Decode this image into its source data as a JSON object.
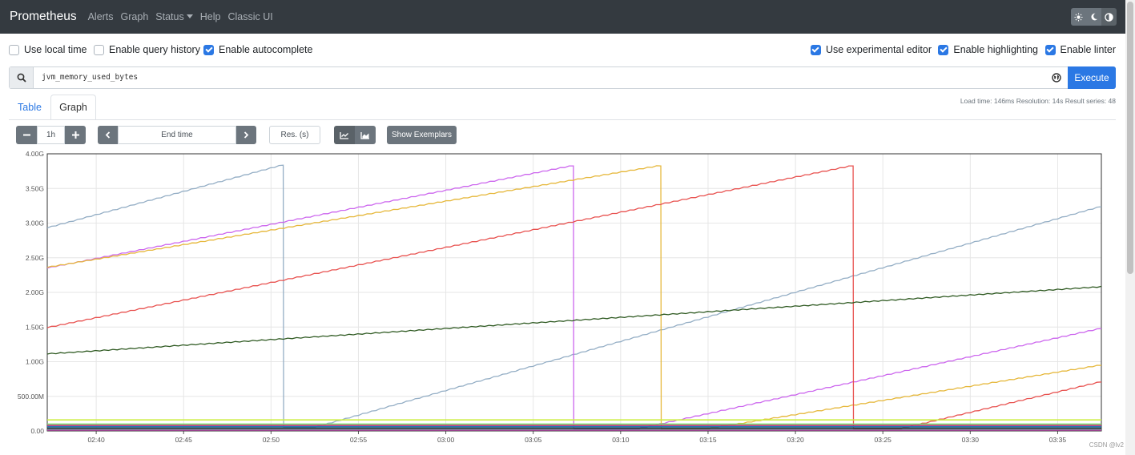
{
  "navbar": {
    "brand": "Prometheus",
    "links": [
      "Alerts",
      "Graph",
      "Status",
      "Help",
      "Classic UI"
    ],
    "theme_icons": [
      "light-theme-icon",
      "dark-theme-icon",
      "auto-theme-icon"
    ]
  },
  "options": {
    "use_local_time": {
      "label": "Use local time",
      "checked": false
    },
    "enable_query_history": {
      "label": "Enable query history",
      "checked": false
    },
    "enable_autocomplete": {
      "label": "Enable autocomplete",
      "checked": true
    },
    "use_experimental_editor": {
      "label": "Use experimental editor",
      "checked": true
    },
    "enable_highlighting": {
      "label": "Enable highlighting",
      "checked": true
    },
    "enable_linter": {
      "label": "Enable linter",
      "checked": true
    }
  },
  "query": {
    "expression": "jvm_memory_used_bytes",
    "execute_label": "Execute"
  },
  "tabs": {
    "table": "Table",
    "graph": "Graph"
  },
  "stats": {
    "text": "Load time: 146ms   Resolution: 14s   Result series: 48"
  },
  "controls": {
    "range": "1h",
    "end_time_placeholder": "End time",
    "resolution_placeholder": "Res. (s)",
    "show_exemplars": "Show Exemplars"
  },
  "colors": {
    "accent": "#2b78e4",
    "navbar": "#343a40"
  },
  "chart_data": {
    "type": "line",
    "y_ticks": [
      "4.00G",
      "3.50G",
      "3.00G",
      "2.50G",
      "2.00G",
      "1.50G",
      "1.00G",
      "500.00M",
      "0.00"
    ],
    "x_ticks": [
      "02:40",
      "02:45",
      "02:50",
      "02:55",
      "03:00",
      "03:05",
      "03:10",
      "03:15",
      "03:20",
      "03:25",
      "03:30",
      "03:35"
    ],
    "x_range_minutes": [
      37.2,
      97.5
    ],
    "ylim": [
      0,
      4.0
    ],
    "grid": true,
    "series": [
      {
        "color": "#94aec5",
        "points": [
          [
            37.2,
            2.93
          ],
          [
            50.7,
            3.84
          ],
          [
            50.72,
            0.05
          ],
          [
            52.5,
            0.05
          ],
          [
            97.5,
            3.24
          ]
        ]
      },
      {
        "color": "#cc66ee",
        "points": [
          [
            37.2,
            2.35
          ],
          [
            67.3,
            3.83
          ],
          [
            67.32,
            0.03
          ],
          [
            71.0,
            0.03
          ],
          [
            97.5,
            1.48
          ]
        ]
      },
      {
        "color": "#e6b83c",
        "points": [
          [
            37.2,
            2.36
          ],
          [
            72.3,
            3.83
          ],
          [
            72.32,
            0.03
          ],
          [
            75.0,
            0.03
          ],
          [
            97.5,
            0.95
          ]
        ]
      },
      {
        "color": "#e8514f",
        "points": [
          [
            37.2,
            1.49
          ],
          [
            83.3,
            3.83
          ],
          [
            83.32,
            0.03
          ],
          [
            86.0,
            0.03
          ],
          [
            97.5,
            0.71
          ]
        ]
      },
      {
        "color": "#2f5a22",
        "points": [
          [
            37.2,
            1.11
          ],
          [
            97.5,
            2.08
          ]
        ]
      },
      {
        "color": "#ccee44",
        "points": [
          [
            37.2,
            0.16
          ],
          [
            97.5,
            0.16
          ]
        ]
      },
      {
        "color": "#7ce06a",
        "points": [
          [
            37.2,
            0.1
          ],
          [
            97.5,
            0.1
          ]
        ]
      },
      {
        "color": "#b6307a",
        "points": [
          [
            37.2,
            0.08
          ],
          [
            97.5,
            0.08
          ]
        ]
      },
      {
        "color": "#1f77b4",
        "points": [
          [
            37.2,
            0.06
          ],
          [
            97.5,
            0.06
          ]
        ]
      },
      {
        "color": "#222222",
        "points": [
          [
            37.2,
            0.04
          ],
          [
            97.5,
            0.04
          ]
        ]
      },
      {
        "color": "#44aa99",
        "points": [
          [
            37.2,
            0.02
          ],
          [
            97.5,
            0.02
          ]
        ]
      },
      {
        "color": "#aa4499",
        "points": [
          [
            37.2,
            0.01
          ],
          [
            97.5,
            0.01
          ]
        ]
      }
    ]
  }
}
